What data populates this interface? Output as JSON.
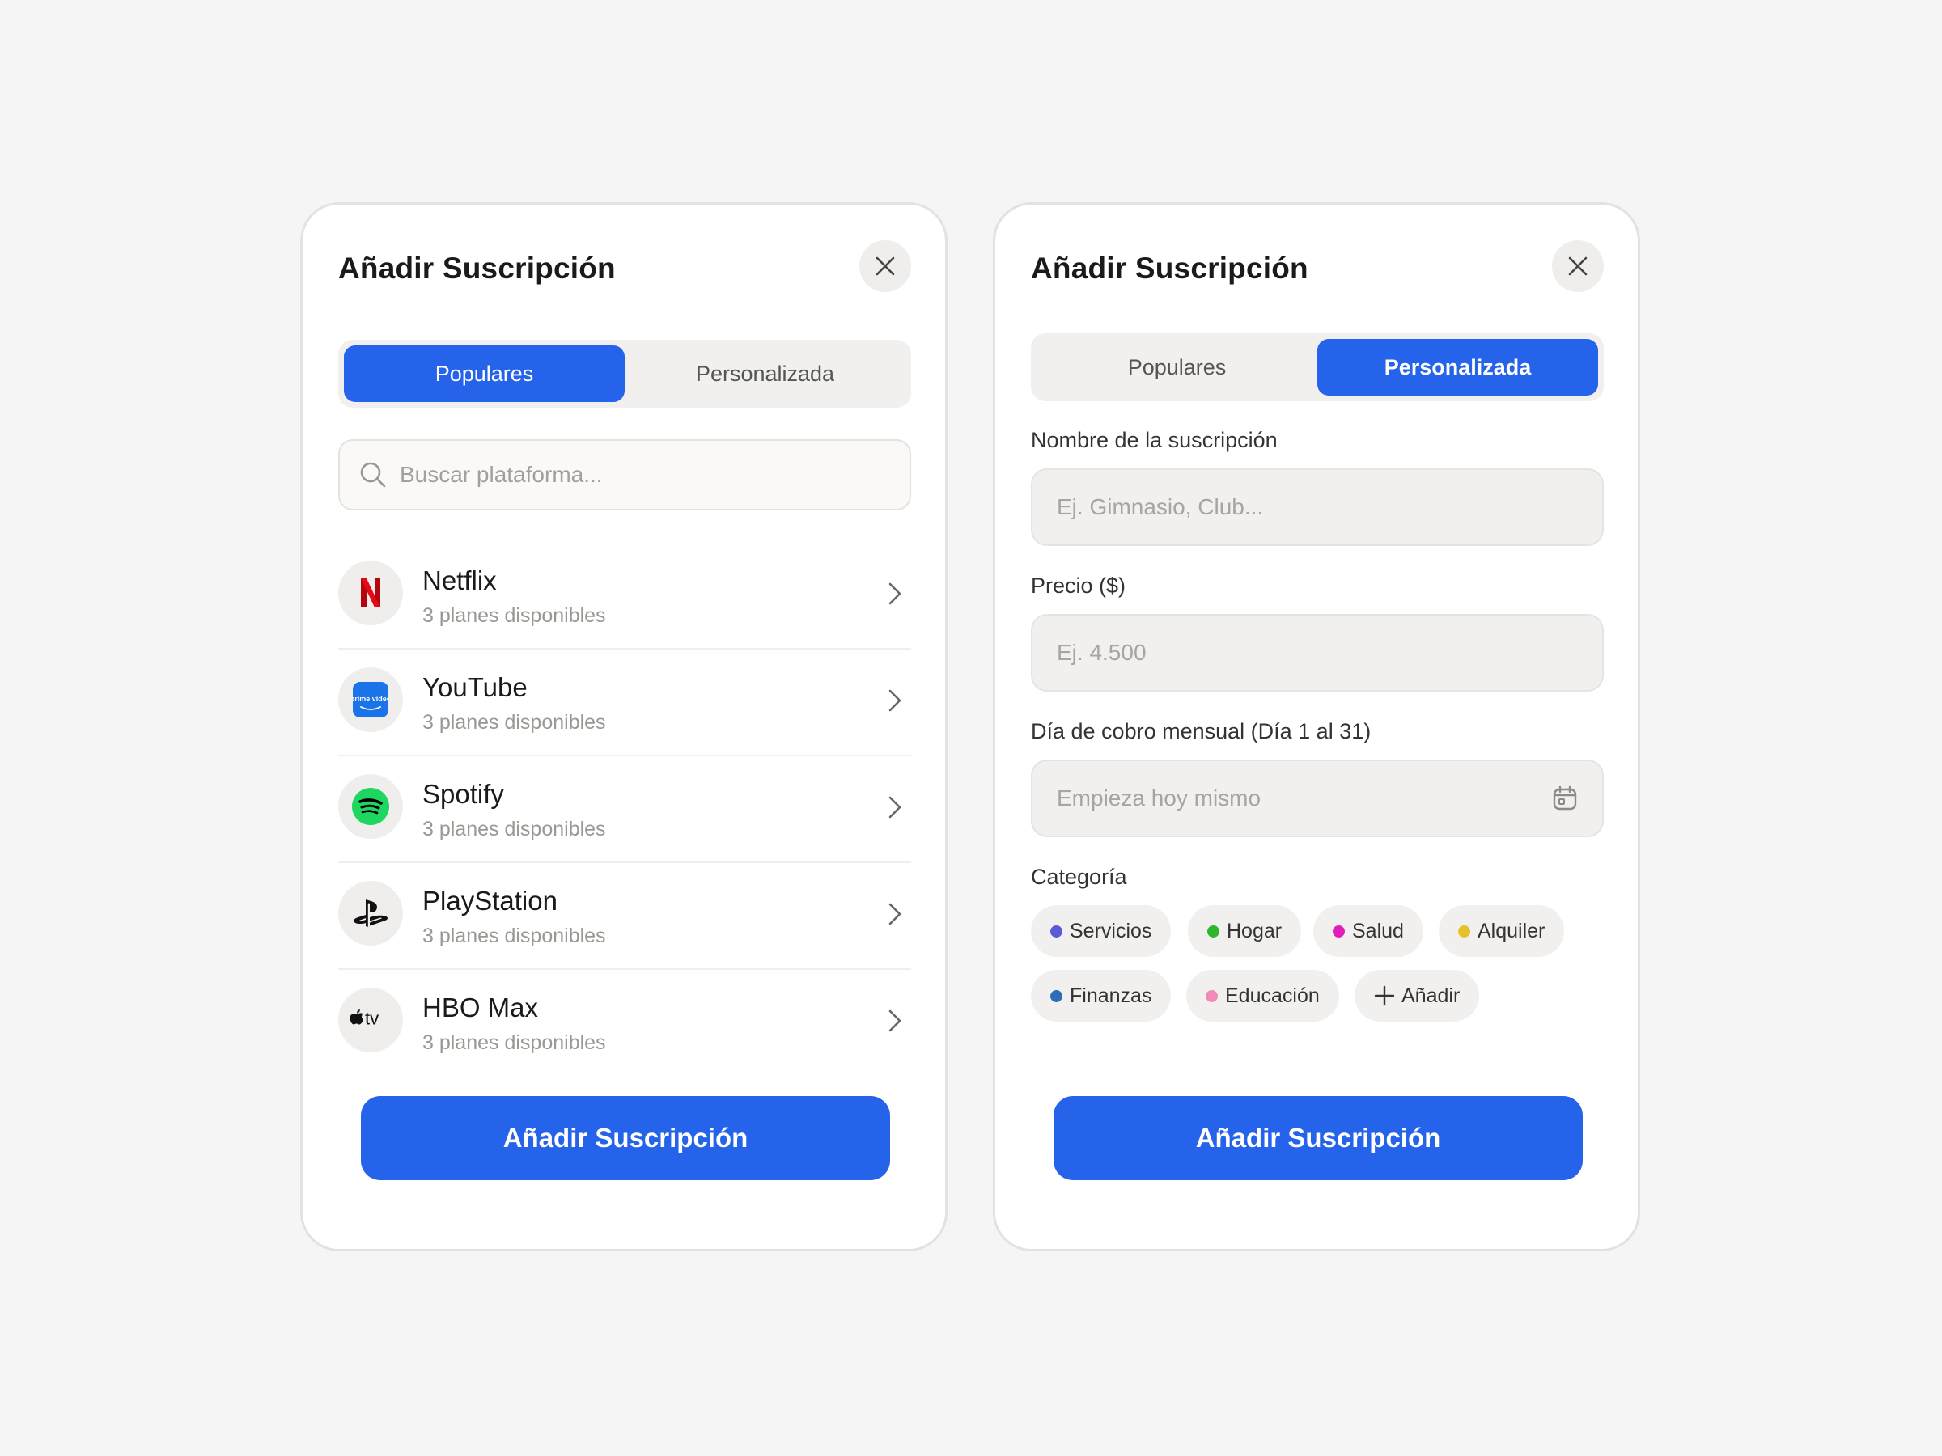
{
  "left_card": {
    "title": "Añadir Suscripción",
    "tabs": [
      {
        "label": "Populares",
        "active": true
      },
      {
        "label": "Personalizada",
        "active": false
      }
    ],
    "search": {
      "placeholder": "Buscar plataforma..."
    },
    "items": [
      {
        "name": "Netflix",
        "subtitle": "3 planes disponibles",
        "icon": "netflix-logo-icon"
      },
      {
        "name": "YouTube",
        "subtitle": "3 planes disponibles",
        "icon": "prime-video-logo-icon",
        "logo_text": "prime video"
      },
      {
        "name": "Spotify",
        "subtitle": "3 planes disponibles",
        "icon": "spotify-logo-icon"
      },
      {
        "name": "PlayStation",
        "subtitle": "3 planes disponibles",
        "icon": "playstation-logo-icon"
      },
      {
        "name": "HBO Max",
        "subtitle": "3 planes disponibles",
        "icon": "apple-tv-logo-icon",
        "logo_text": "tv"
      }
    ],
    "submit_label": "Añadir Suscripción"
  },
  "right_card": {
    "title": "Añadir Suscripción",
    "tabs": [
      {
        "label": "Populares",
        "active": false
      },
      {
        "label": "Personalizada",
        "active": true
      }
    ],
    "fields": [
      {
        "label": "Nombre de la suscripción",
        "placeholder": "Ej. Gimnasio, Club..."
      },
      {
        "label": "Precio ($)",
        "placeholder": "Ej. 4.500"
      },
      {
        "label": "Día de cobro mensual (Día 1 al 31)",
        "placeholder": "Empieza hoy mismo",
        "icon": "calendar-icon"
      }
    ],
    "category_label": "Categoría",
    "categories": [
      {
        "label": "Servicios",
        "color": "#5b5bd6"
      },
      {
        "label": "Hogar",
        "color": "#2fb52f"
      },
      {
        "label": "Salud",
        "color": "#e01fb8"
      },
      {
        "label": "Alquiler",
        "color": "#e6c12a"
      },
      {
        "label": "Finanzas",
        "color": "#2f6db5"
      },
      {
        "label": "Educación",
        "color": "#f28ab5"
      }
    ],
    "add_category_label": "Añadir",
    "submit_label": "Añadir Suscripción"
  },
  "colors": {
    "accent": "#2563eb",
    "background": "#f5f5f5",
    "card": "#ffffff",
    "netflix": "#e50914",
    "prime": "#1a73e8",
    "spotify": "#1ed760"
  }
}
